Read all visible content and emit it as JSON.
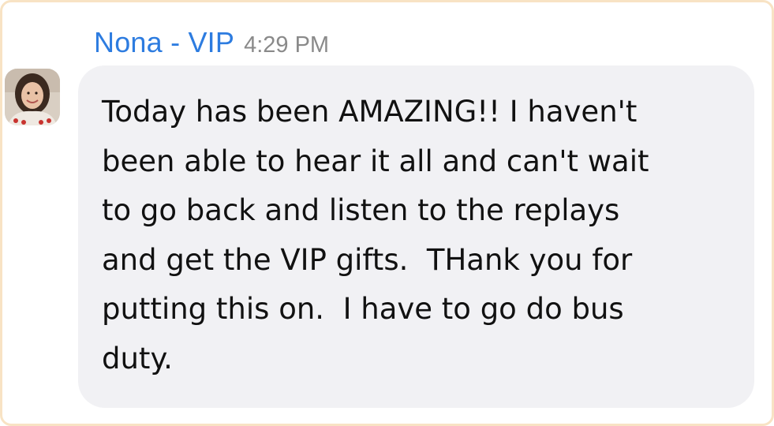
{
  "message": {
    "sender_name": "Nona - VIP",
    "timestamp": "4:29 PM",
    "avatar_icon": "user-avatar-photo",
    "lines": [
      "Today has been AMAZING!! I haven't",
      "been able to hear it all and can't wait",
      "to go back and listen to the replays",
      "and get the VIP gifts.  THank you for",
      "putting this on.  I have to go do bus",
      "duty."
    ]
  },
  "colors": {
    "sender_name": "#2d7ce0",
    "timestamp": "#8a8a8a",
    "bubble_background": "#f1f1f4",
    "frame_border": "#f8e3c4",
    "text": "#111111"
  }
}
